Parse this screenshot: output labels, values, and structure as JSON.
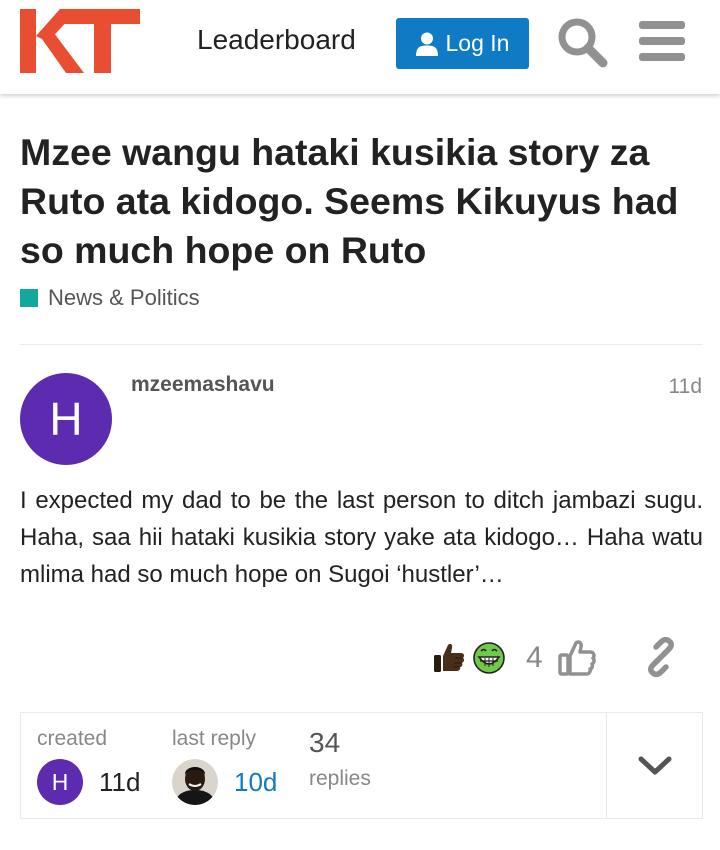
{
  "header": {
    "logo_text": "KT",
    "leaderboard_label": "Leaderboard",
    "login_label": "Log In",
    "icons": {
      "user": "user-icon",
      "search": "search-icon",
      "menu": "hamburger-menu-icon"
    },
    "colors": {
      "logo": "#e94e32",
      "login_bg": "#0f7bc4"
    }
  },
  "topic": {
    "title": "Mzee wangu hataki kusikia story za Ruto ata kidogo. Seems Kikuyus had so much hope on Ruto",
    "category": {
      "label": "News & Politics",
      "color": "#12a89d"
    }
  },
  "post": {
    "avatar_letter": "H",
    "avatar_color": "#5d2bb0",
    "username": "mzeemashavu",
    "date": "11d",
    "body": "I expected my dad to be the last person to ditch jambazi sugu. Haha, saa hii hataki kusikia story yake ata kidogo… Haha watu mlima had so much hope on Sugoi ‘hustler’…",
    "reactions": {
      "emojis": [
        "thumbs-up-dark-skin-emoji",
        "grinning-green-face-emoji"
      ],
      "count": "4"
    },
    "actions": {
      "like_icon": "thumbs-up-outline-icon",
      "share_icon": "link-icon"
    }
  },
  "summary": {
    "created_label": "created",
    "created_avatar_letter": "H",
    "created_value": "11d",
    "last_reply_label": "last reply",
    "last_reply_value": "10d",
    "replies_count": "34",
    "replies_label": "replies",
    "expand_icon": "chevron-down-icon"
  }
}
